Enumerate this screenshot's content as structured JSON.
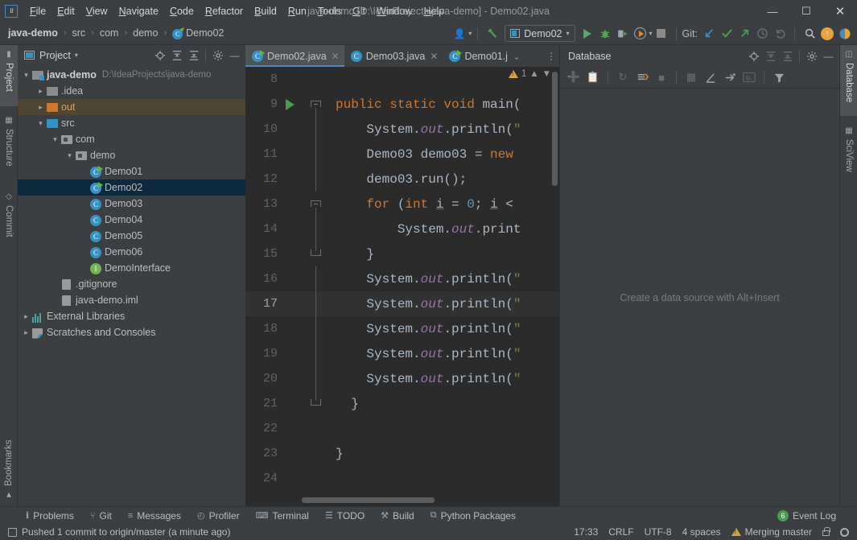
{
  "window": {
    "title": "java-demo [D:\\IdeaProjects\\java-demo] - Demo02.java",
    "minimize": "—",
    "maximize": "☐",
    "close": "✕",
    "logo": "IJ"
  },
  "menu": {
    "items": [
      {
        "label": "File"
      },
      {
        "label": "Edit"
      },
      {
        "label": "View"
      },
      {
        "label": "Navigate"
      },
      {
        "label": "Code"
      },
      {
        "label": "Refactor"
      },
      {
        "label": "Build"
      },
      {
        "label": "Run"
      },
      {
        "label": "Tools"
      },
      {
        "label": "Git"
      },
      {
        "label": "Window"
      },
      {
        "label": "Help"
      }
    ]
  },
  "navbar": {
    "breadcrumbs": [
      {
        "label": "java-demo"
      },
      {
        "label": "src"
      },
      {
        "label": "com"
      },
      {
        "label": "demo"
      },
      {
        "label": "Demo02"
      }
    ],
    "separator": "›",
    "run_config": "Demo02",
    "git_label": "Git:",
    "icons": {
      "profile": "person-icon",
      "build_hammer": "hammer-icon",
      "run": "run-icon",
      "debug": "debug-icon",
      "run_coverage": "run-with-coverage-icon",
      "profiler": "profiler-icon",
      "stop": "stop-icon",
      "git_update": "git-update-project-icon",
      "git_commit": "git-commit-icon",
      "git_push": "git-push-icon",
      "git_history": "git-history-icon",
      "git_rollback": "git-rollback-icon",
      "search": "search-everywhere-icon",
      "updates": "updates-available-icon",
      "feedback": "ide-feedback-icon"
    }
  },
  "left_stripe": {
    "tabs": [
      {
        "label": "Project",
        "icon": "project-icon",
        "active": true
      },
      {
        "label": "Structure",
        "icon": "structure-icon",
        "active": false
      },
      {
        "label": "Commit",
        "icon": "commit-icon",
        "active": false
      },
      {
        "label": "Bookmarks",
        "icon": "bookmarks-icon",
        "active": false
      }
    ]
  },
  "right_stripe": {
    "tabs": [
      {
        "label": "Database",
        "icon": "database-icon",
        "active": true
      },
      {
        "label": "SciView",
        "icon": "sciview-icon",
        "active": false
      }
    ]
  },
  "project_panel": {
    "title": "Project",
    "tools": [
      "locate-icon",
      "expand-all-icon",
      "collapse-all-icon",
      "settings-gear-icon",
      "hide-icon"
    ],
    "tree": [
      {
        "indent": 0,
        "twisty": "∨",
        "icon": "module-icon",
        "label": "java-demo",
        "bold": true,
        "path": "D:\\IdeaProjects\\java-demo",
        "state": "normal"
      },
      {
        "indent": 1,
        "twisty": "›",
        "icon": "folder-gray-icon",
        "label": ".idea",
        "bold": false,
        "path": "",
        "state": "normal"
      },
      {
        "indent": 1,
        "twisty": "›",
        "icon": "folder-orange-icon",
        "label": "out",
        "bold": false,
        "path": "",
        "state": "out"
      },
      {
        "indent": 1,
        "twisty": "∨",
        "icon": "folder-blue-icon",
        "label": "src",
        "bold": false,
        "path": "",
        "state": "normal"
      },
      {
        "indent": 2,
        "twisty": "∨",
        "icon": "package-icon",
        "label": "com",
        "bold": false,
        "path": "",
        "state": "normal"
      },
      {
        "indent": 3,
        "twisty": "∨",
        "icon": "package-icon",
        "label": "demo",
        "bold": false,
        "path": "",
        "state": "normal"
      },
      {
        "indent": 4,
        "twisty": "",
        "icon": "class-runnable-icon",
        "label": "Demo01",
        "bold": false,
        "path": "",
        "state": "normal"
      },
      {
        "indent": 4,
        "twisty": "",
        "icon": "class-runnable-icon",
        "label": "Demo02",
        "bold": false,
        "path": "",
        "state": "selected"
      },
      {
        "indent": 4,
        "twisty": "",
        "icon": "class-icon",
        "label": "Demo03",
        "bold": false,
        "path": "",
        "state": "normal"
      },
      {
        "indent": 4,
        "twisty": "",
        "icon": "class-icon",
        "label": "Demo04",
        "bold": false,
        "path": "",
        "state": "normal"
      },
      {
        "indent": 4,
        "twisty": "",
        "icon": "class-icon",
        "label": "Demo05",
        "bold": false,
        "path": "",
        "state": "normal"
      },
      {
        "indent": 4,
        "twisty": "",
        "icon": "class-icon",
        "label": "Demo06",
        "bold": false,
        "path": "",
        "state": "normal"
      },
      {
        "indent": 4,
        "twisty": "",
        "icon": "interface-icon",
        "label": "DemoInterface",
        "bold": false,
        "path": "",
        "state": "normal"
      },
      {
        "indent": 2,
        "twisty": "",
        "icon": "gitignore-file-icon",
        "label": ".gitignore",
        "bold": false,
        "path": "",
        "state": "normal"
      },
      {
        "indent": 2,
        "twisty": "",
        "icon": "iml-file-icon",
        "label": "java-demo.iml",
        "bold": false,
        "path": "",
        "state": "normal"
      },
      {
        "indent": 0,
        "twisty": "›",
        "icon": "external-libraries-icon",
        "label": "External Libraries",
        "bold": false,
        "path": "",
        "state": "normal"
      },
      {
        "indent": 0,
        "twisty": "›",
        "icon": "scratches-icon",
        "label": "Scratches and Consoles",
        "bold": false,
        "path": "",
        "state": "normal"
      }
    ]
  },
  "editor": {
    "tabs": [
      {
        "label": "Demo02.java",
        "icon": "class-runnable-icon",
        "active": true,
        "close": "✕"
      },
      {
        "label": "Demo03.java",
        "icon": "class-icon",
        "active": false,
        "close": "✕"
      },
      {
        "label": "Demo01.j",
        "icon": "class-runnable-icon",
        "active": false,
        "close": "⌄"
      }
    ],
    "tab_overflow": "⋮",
    "inspection": {
      "warnings": "1",
      "up": "⌃",
      "down": "⌄"
    },
    "lines": [
      {
        "num": "8",
        "current": false,
        "html": ""
      },
      {
        "num": "9",
        "current": false,
        "html": "<span class=\"kw\">public static void</span> <span class=\"id\">main</span><span class=\"id\">(</span>"
      },
      {
        "num": "10",
        "current": false,
        "html": "    <span class=\"id\">System.</span><span class=\"fld\">out</span><span class=\"id\">.println(</span><span class=\"str\">\"</span>"
      },
      {
        "num": "11",
        "current": false,
        "html": "    <span class=\"id\">Demo03 demo03 = </span><span class=\"kw\">new</span>"
      },
      {
        "num": "12",
        "current": false,
        "html": "    <span class=\"id\">demo03.run();</span>"
      },
      {
        "num": "13",
        "current": false,
        "html": "    <span class=\"kw\">for</span><span class=\"id\"> (</span><span class=\"kw\">int</span> <span class=\"var-u\">i</span><span class=\"id\"> = </span><span class=\"num\">0</span><span class=\"id\">; </span><span class=\"var-u\">i</span><span class=\"id\"> &lt;</span>"
      },
      {
        "num": "14",
        "current": false,
        "html": "        <span class=\"id\">System.</span><span class=\"fld\">out</span><span class=\"id\">.print</span>"
      },
      {
        "num": "15",
        "current": false,
        "html": "    <span class=\"id\">}</span>"
      },
      {
        "num": "16",
        "current": false,
        "html": "    <span class=\"id\">System.</span><span class=\"fld\">out</span><span class=\"id\">.println(</span><span class=\"str\">\"</span>"
      },
      {
        "num": "17",
        "current": true,
        "html": "    <span class=\"id\">System.</span><span class=\"fld\">out</span><span class=\"id\">.println(</span><span class=\"str\">\"</span>"
      },
      {
        "num": "18",
        "current": false,
        "html": "    <span class=\"id\">System.</span><span class=\"fld\">out</span><span class=\"id\">.println(</span><span class=\"str\">\"</span>"
      },
      {
        "num": "19",
        "current": false,
        "html": "    <span class=\"id\">System.</span><span class=\"fld\">out</span><span class=\"id\">.println(</span><span class=\"str\">\"</span>"
      },
      {
        "num": "20",
        "current": false,
        "html": "    <span class=\"id\">System.</span><span class=\"fld\">out</span><span class=\"id\">.println(</span><span class=\"str\">\"</span>"
      },
      {
        "num": "21",
        "current": false,
        "html": "  <span class=\"id\">}</span>"
      },
      {
        "num": "22",
        "current": false,
        "html": ""
      },
      {
        "num": "23",
        "current": false,
        "html": "<span class=\"id\">}</span>"
      },
      {
        "num": "24",
        "current": false,
        "html": ""
      }
    ]
  },
  "database_panel": {
    "title": "Database",
    "header_tools": [
      "locate-icon",
      "expand-all-icon",
      "collapse-all-icon",
      "settings-gear-icon",
      "hide-icon"
    ],
    "toolbar": [
      "add-icon",
      "duplicate-icon",
      "refresh-icon",
      "sync-icon",
      "stop-icon",
      "table-icon",
      "modify-icon",
      "jump-icon",
      "ql-console-icon",
      "filter-icon"
    ],
    "empty_message": "Create a data source with Alt+Insert"
  },
  "bottom_toolwindows": {
    "items": [
      {
        "label": "Problems",
        "icon": "problems-icon"
      },
      {
        "label": "Git",
        "icon": "git-branch-icon"
      },
      {
        "label": "Messages",
        "icon": "messages-icon"
      },
      {
        "label": "Profiler",
        "icon": "profiler-icon"
      },
      {
        "label": "Terminal",
        "icon": "terminal-icon"
      },
      {
        "label": "TODO",
        "icon": "todo-icon"
      },
      {
        "label": "Build",
        "icon": "build-hammer-icon"
      },
      {
        "label": "Python Packages",
        "icon": "python-packages-icon"
      }
    ],
    "event_log": {
      "label": "Event Log",
      "count": "6"
    }
  },
  "statusbar": {
    "message": "Pushed 1 commit to origin/master (a minute ago)",
    "time": "17:33",
    "line_separator": "CRLF",
    "encoding": "UTF-8",
    "indent": "4 spaces",
    "branch": "Merging master",
    "lock_icon": "read-only-lock-icon",
    "inspector_icon": "inspection-settings-icon"
  },
  "colors": {
    "chrome": "#3c3f41",
    "editor_bg": "#2b2b2b",
    "accent_blue": "#4a88c7",
    "selection": "#0d293e",
    "out_folder": "#4e4533",
    "keyword_orange": "#cc7832",
    "green_run": "#499c54",
    "warning_amber": "#d9a343"
  }
}
